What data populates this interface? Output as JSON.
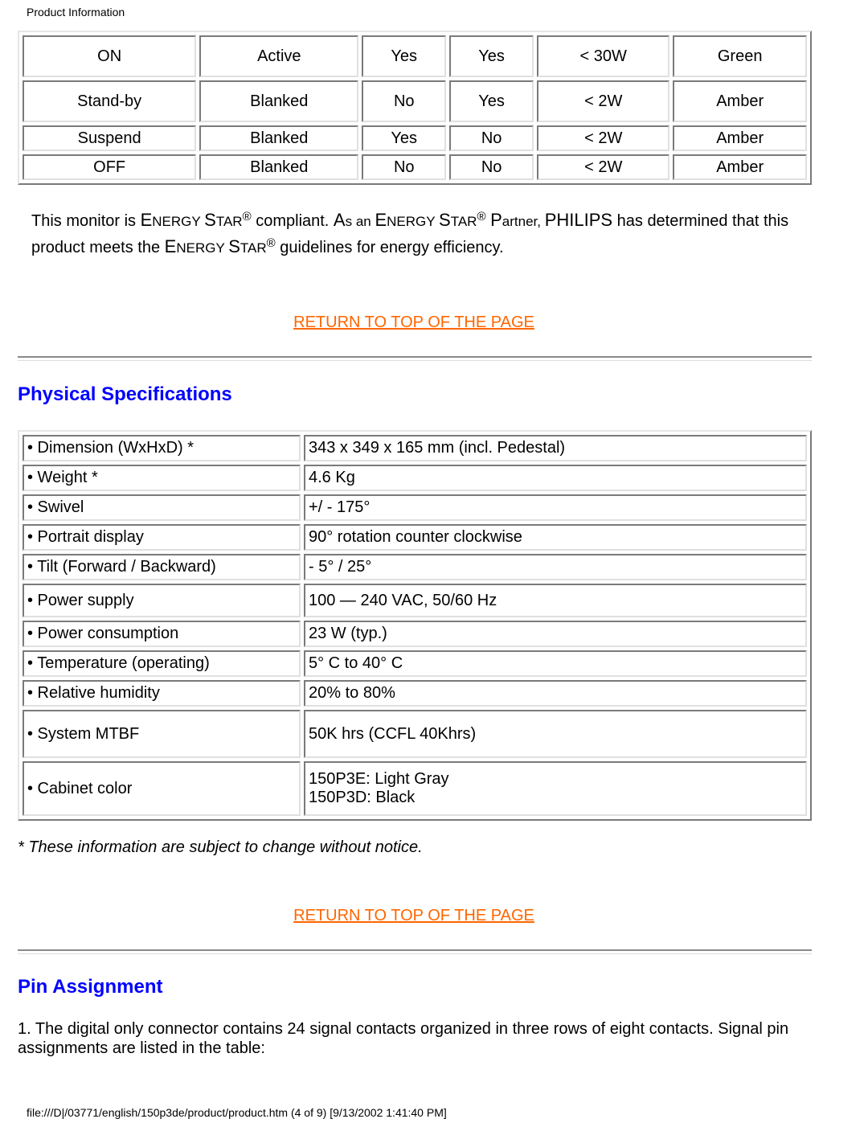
{
  "header": {
    "title": "Product Information"
  },
  "power_table": {
    "rows": [
      [
        "ON",
        "Active",
        "Yes",
        "Yes",
        "< 30W",
        "Green"
      ],
      [
        "Stand-by",
        "Blanked",
        "No",
        "Yes",
        "< 2W",
        "Amber"
      ],
      [
        "Suspend",
        "Blanked",
        "Yes",
        "No",
        "< 2W",
        "Amber"
      ],
      [
        "OFF",
        "Blanked",
        "No",
        "No",
        "< 2W",
        "Amber"
      ]
    ]
  },
  "energy_star": {
    "p1": "This monitor is ",
    "es_E": "E",
    "es_NERGY": "NERGY ",
    "es_S": "S",
    "es_TAR": "TAR",
    "reg": "®",
    "p2": " compliant. ",
    "as_A": "A",
    "as_rest": "s an ",
    "p3": " ",
    "partner_P": "P",
    "partner_rest": "artner, ",
    "philips": "PHILIPS",
    "p4": " has determined that this product meets the ",
    "p5": " guidelines for energy efficiency."
  },
  "links": {
    "return_top": "RETURN TO TOP OF THE PAGE"
  },
  "colors": {
    "link": "#ff6600",
    "heading": "#0000ff"
  },
  "physical": {
    "heading": "Physical Specifications",
    "rows": [
      {
        "label": "• Dimension (WxHxD) *",
        "value": "343 x 349 x 165 mm (incl. Pedestal)"
      },
      {
        "label": "• Weight *",
        "value": "4.6 Kg"
      },
      {
        "label": "• Swivel",
        "value": "+/ - 175°"
      },
      {
        "label": "• Portrait display",
        "value": "90° rotation counter clockwise"
      },
      {
        "label": "• Tilt (Forward / Backward)",
        "value": "- 5° / 25°"
      },
      {
        "label": "• Power supply",
        "value": "100 — 240 VAC, 50/60 Hz"
      },
      {
        "label": "• Power consumption",
        "value": "23 W (typ.)"
      },
      {
        "label": "• Temperature (operating)",
        "value": "5° C to 40° C"
      },
      {
        "label": "• Relative humidity",
        "value": "20% to 80%"
      },
      {
        "label": "• System MTBF",
        "value": "50K hrs (CCFL 40Khrs)"
      },
      {
        "label": "• Cabinet color",
        "value_lines": [
          "150P3E: Light Gray",
          "150P3D: Black"
        ]
      }
    ],
    "disclaimer": "* These information are subject to change without notice."
  },
  "pin": {
    "heading": "Pin Assignment",
    "text": "1. The digital only connector contains 24 signal contacts organized in three rows of eight contacts. Signal pin assignments are listed in the table:"
  },
  "footer": {
    "path": "file:///D|/03771/english/150p3de/product/product.htm (4 of 9) [9/13/2002 1:41:40 PM]"
  }
}
